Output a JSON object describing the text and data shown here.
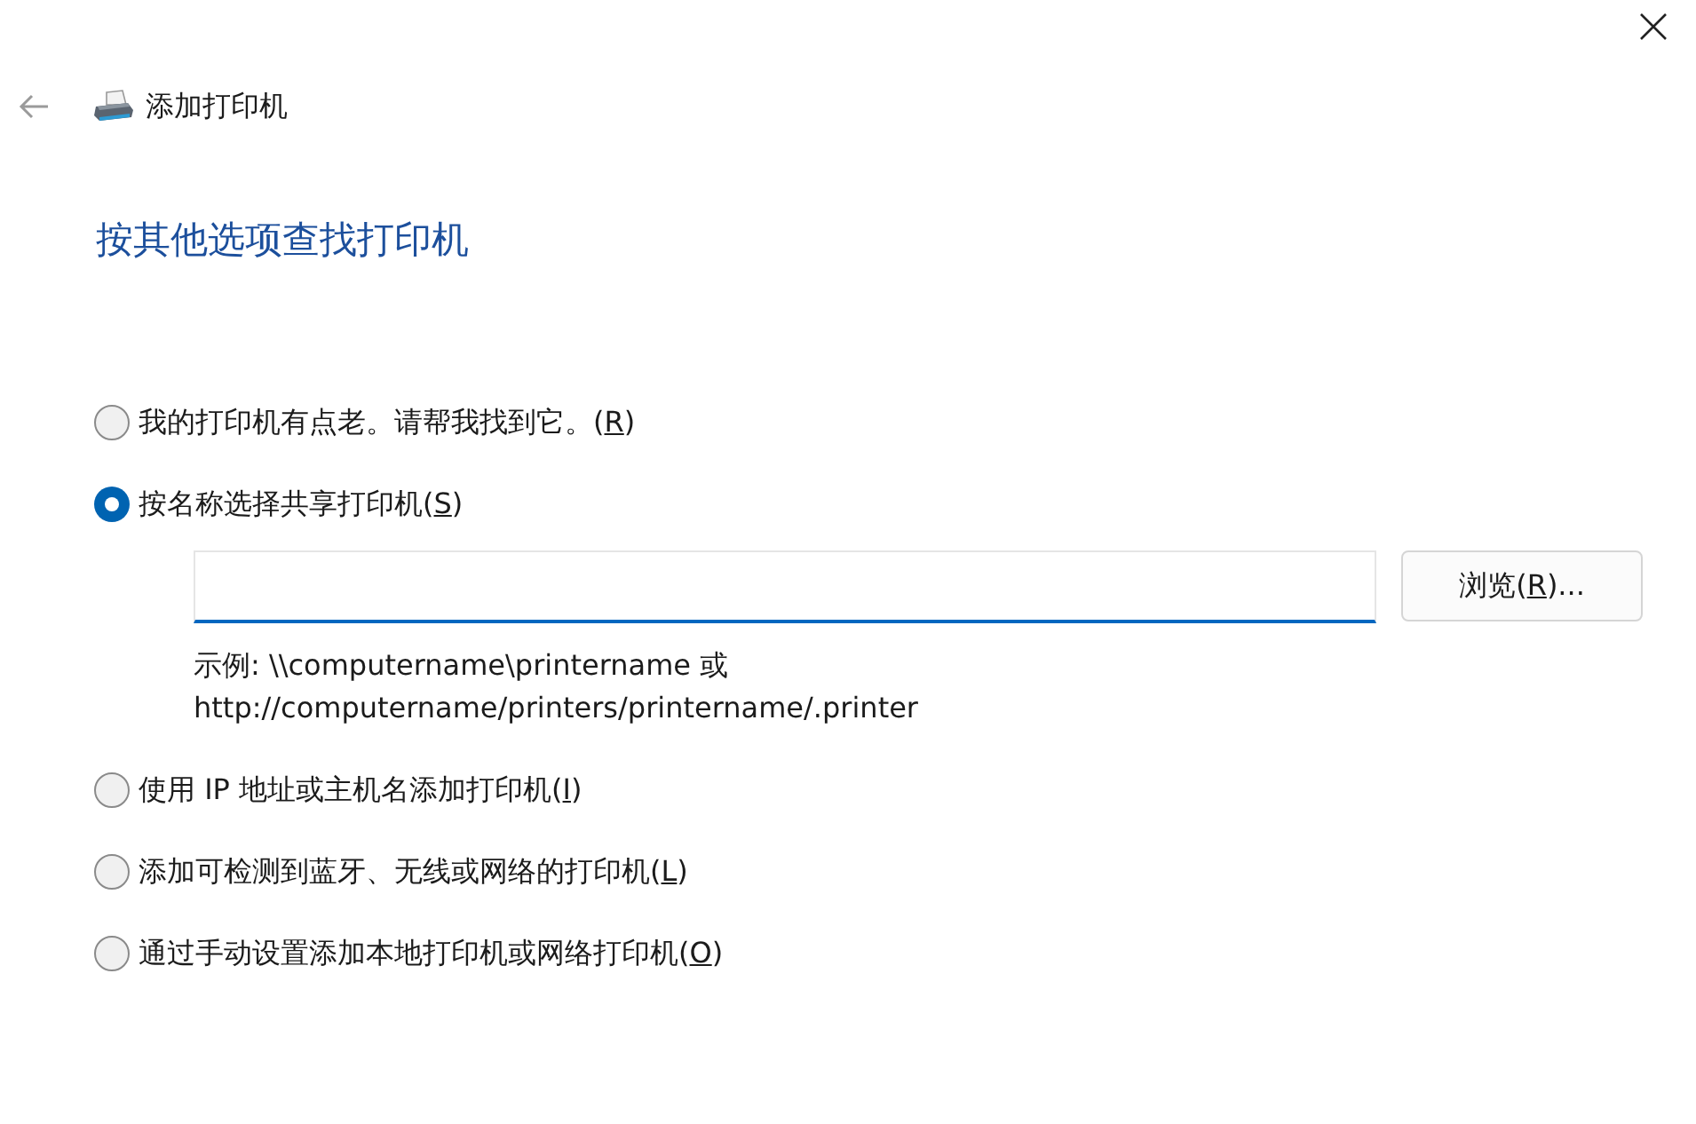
{
  "window": {
    "title": "添加打印机"
  },
  "heading": "按其他选项查找打印机",
  "options": [
    {
      "before": "我的打印机有点老。请帮我找到它。(",
      "access_key": "R",
      "after": ")",
      "selected": false
    },
    {
      "before": "按名称选择共享打印机(",
      "access_key": "S",
      "after": ")",
      "selected": true,
      "field": {
        "focused": true
      },
      "browse": {
        "before": "浏览(",
        "access_key": "R",
        "after": ")..."
      },
      "example": [
        "示例: \\\\computername\\printername 或",
        "http://computername/printers/printername/.printer"
      ]
    },
    {
      "before": "使用 IP 地址或主机名添加打印机(",
      "access_key": "I",
      "after": ")",
      "selected": false
    },
    {
      "before": "添加可检测到蓝牙、无线或网络的打印机(",
      "access_key": "L",
      "after": ")",
      "selected": false
    },
    {
      "before": "通过手动设置添加本地打印机或网络打印机(",
      "access_key": "O",
      "after": ")",
      "selected": false
    }
  ]
}
